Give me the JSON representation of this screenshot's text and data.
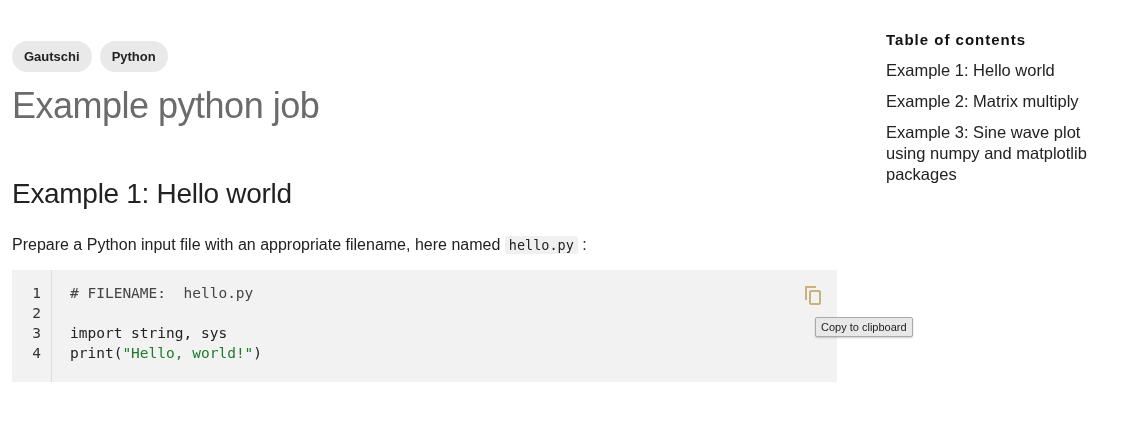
{
  "tags": [
    "Gautschi",
    "Python"
  ],
  "title": "Example python job",
  "section_heading": "Example 1: Hello world",
  "paragraph": [
    {
      "kind": "text",
      "text": "Prepare a Python input file with an appropriate filename, here named "
    },
    {
      "kind": "code",
      "text": "hello.py"
    },
    {
      "kind": "text",
      "text": " :"
    }
  ],
  "code_block": {
    "lines": [
      {
        "number": "1",
        "tokens": [
          {
            "kind": "comment",
            "text": "# FILENAME:  hello.py"
          }
        ]
      },
      {
        "number": "2"
      },
      {
        "number": "3",
        "tokens": [
          {
            "kind": "plain",
            "text": "import string, sys"
          }
        ]
      },
      {
        "number": "4",
        "tokens": [
          {
            "kind": "plain",
            "text": "print("
          },
          {
            "kind": "string",
            "text": "\"Hello, world!\""
          },
          {
            "kind": "plain",
            "text": ")"
          }
        ]
      }
    ],
    "copy_tooltip": "Copy to clipboard"
  },
  "toc": {
    "title": "Table of contents",
    "items": [
      "Example 1: Hello world",
      "Example 2: Matrix multiply",
      "Example 3: Sine wave plot using numpy and matplotlib packages"
    ]
  }
}
